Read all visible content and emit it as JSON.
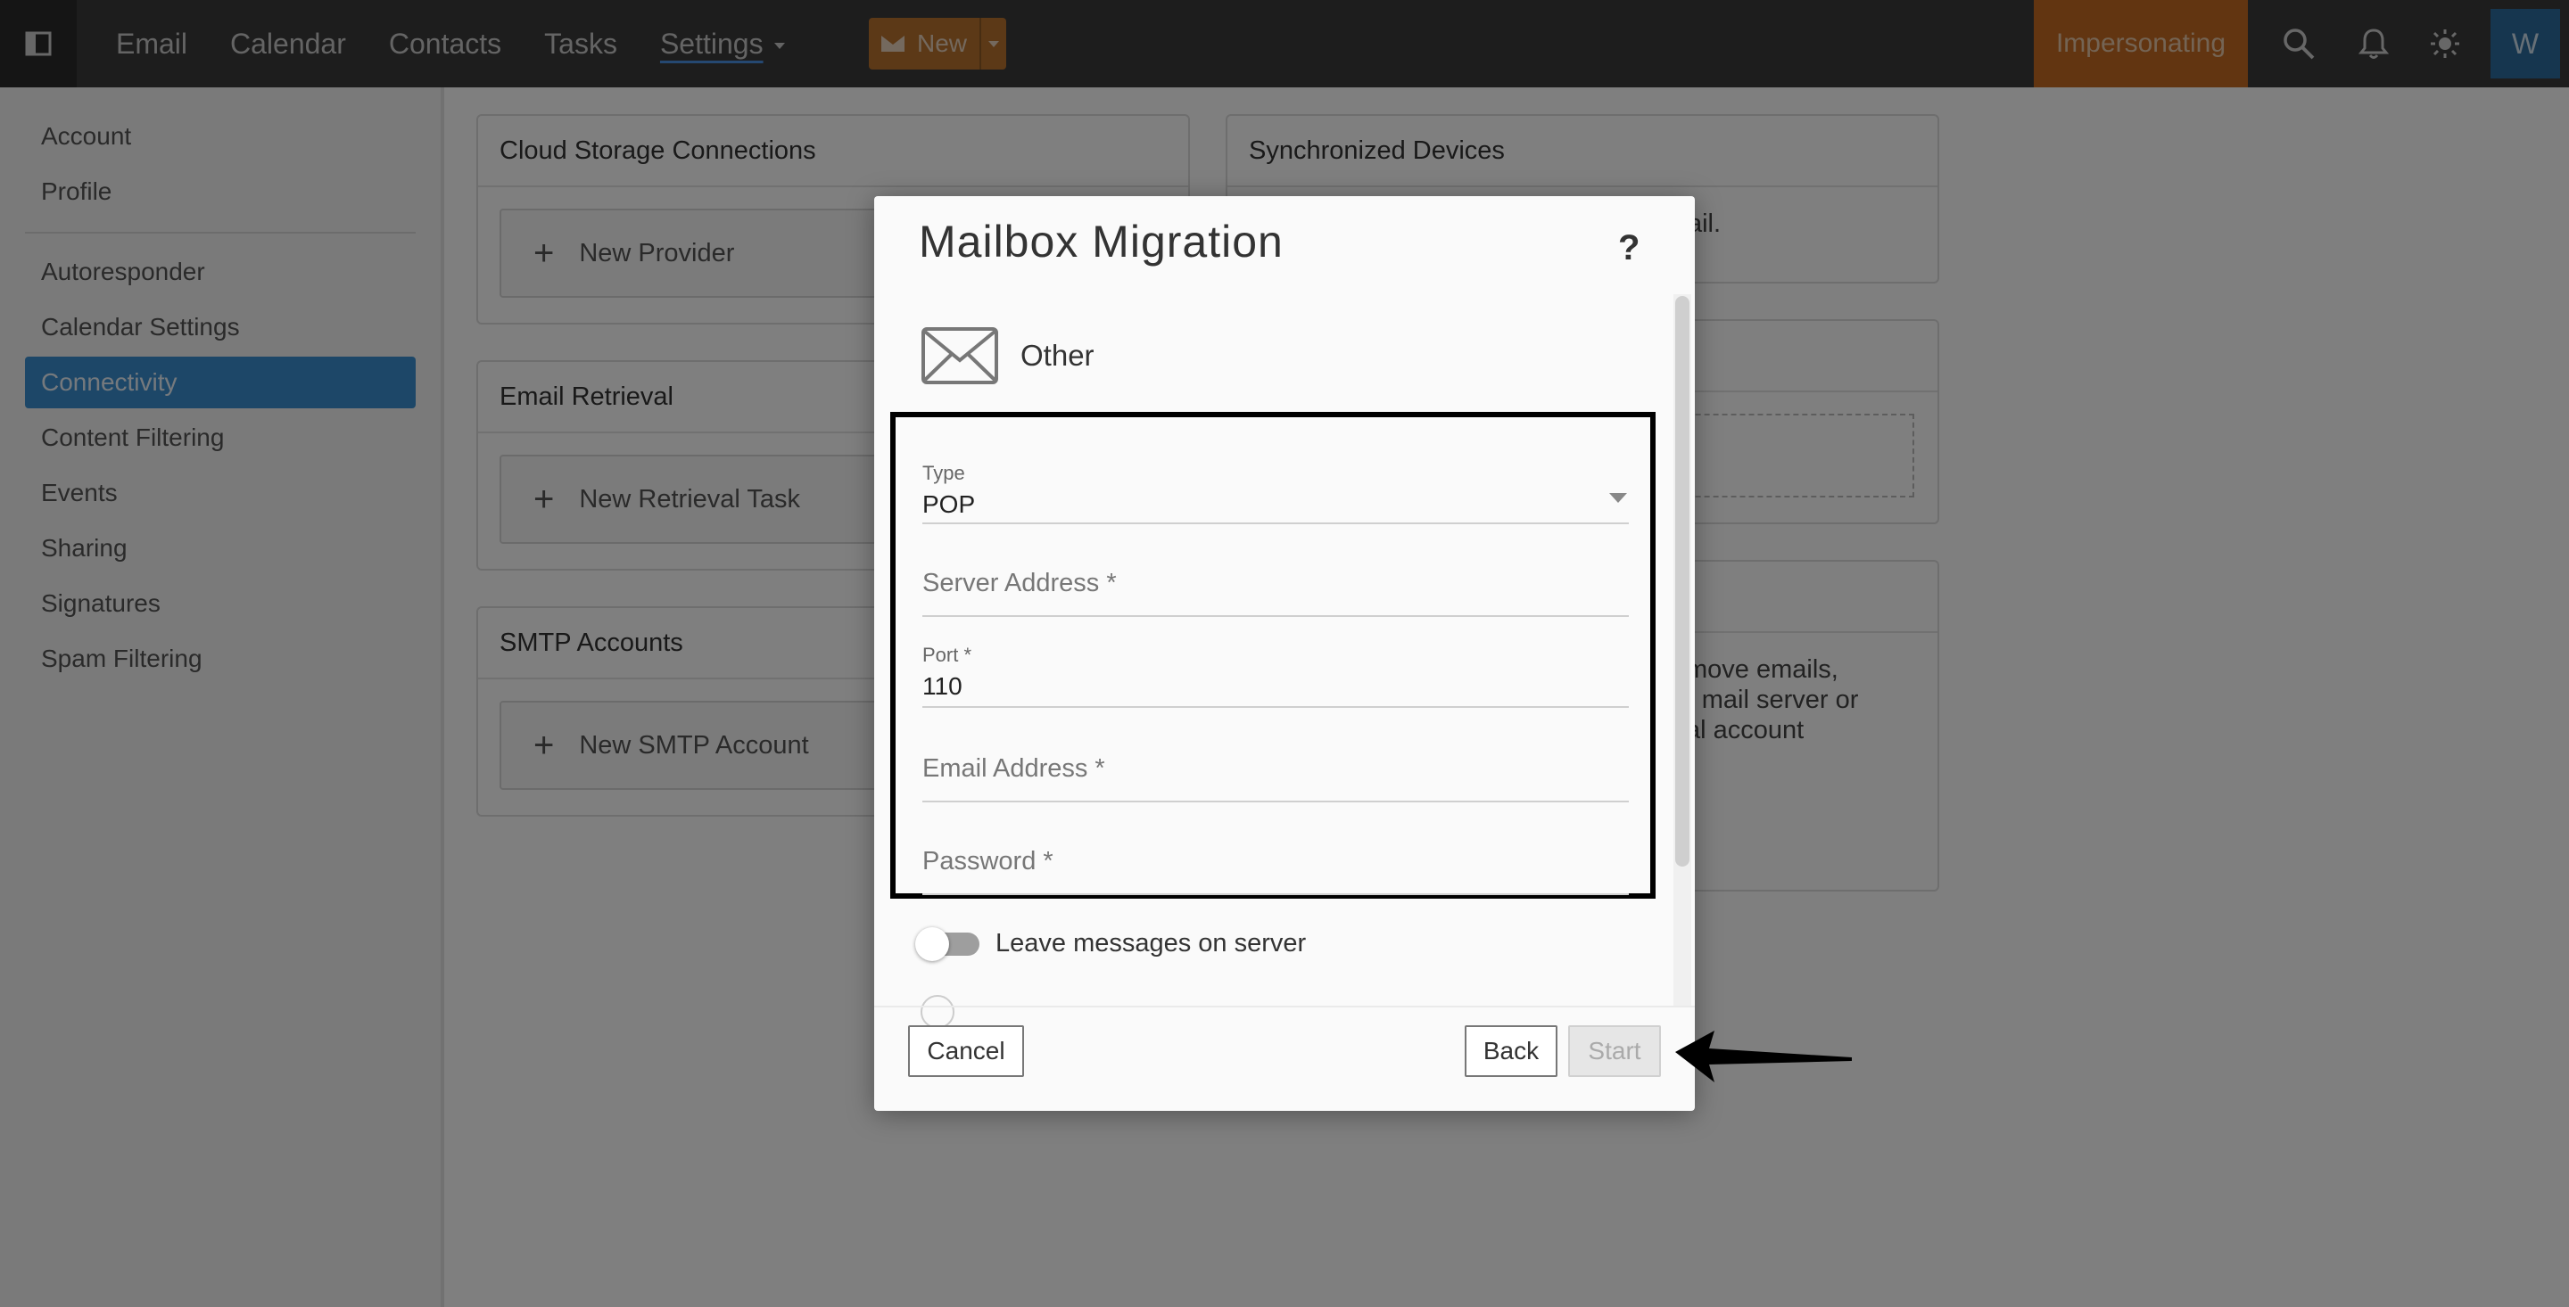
{
  "topbar": {
    "nav": [
      "Email",
      "Calendar",
      "Contacts",
      "Tasks",
      "Settings"
    ],
    "new_label": "New",
    "impersonating_label": "Impersonating",
    "avatar_initial": "W",
    "icons": [
      "sidebar-toggle-icon",
      "search-icon",
      "bell-icon",
      "sun-icon"
    ]
  },
  "sidebar": {
    "group1": [
      "Account",
      "Profile"
    ],
    "group2": [
      "Autoresponder",
      "Calendar Settings",
      "Connectivity",
      "Content Filtering",
      "Events",
      "Sharing",
      "Signatures",
      "Spam Filtering"
    ],
    "active": "Connectivity"
  },
  "panels": {
    "cloud_storage": {
      "title": "Cloud Storage Connections",
      "button": "New Provider"
    },
    "email_retrieval": {
      "title": "Email Retrieval",
      "button": "New Retrieval Task"
    },
    "smtp": {
      "title": "SMTP Accounts",
      "button": "New SMTP Account"
    },
    "sync_devices": {
      "title": "Synchronized Devices",
      "text": "erMail."
    },
    "migration_text": [
      "move emails,",
      "r mail server or",
      "al account"
    ]
  },
  "modal": {
    "title": "Mailbox Migration",
    "help": "?",
    "provider": "Other",
    "type_label": "Type",
    "type_value": "POP",
    "server_placeholder": "Server Address *",
    "port_label": "Port *",
    "port_value": "110",
    "email_placeholder": "Email Address *",
    "password_placeholder": "Password *",
    "leave_messages_label": "Leave messages on server",
    "leave_messages_on": false,
    "cancel": "Cancel",
    "back": "Back",
    "start": "Start"
  }
}
